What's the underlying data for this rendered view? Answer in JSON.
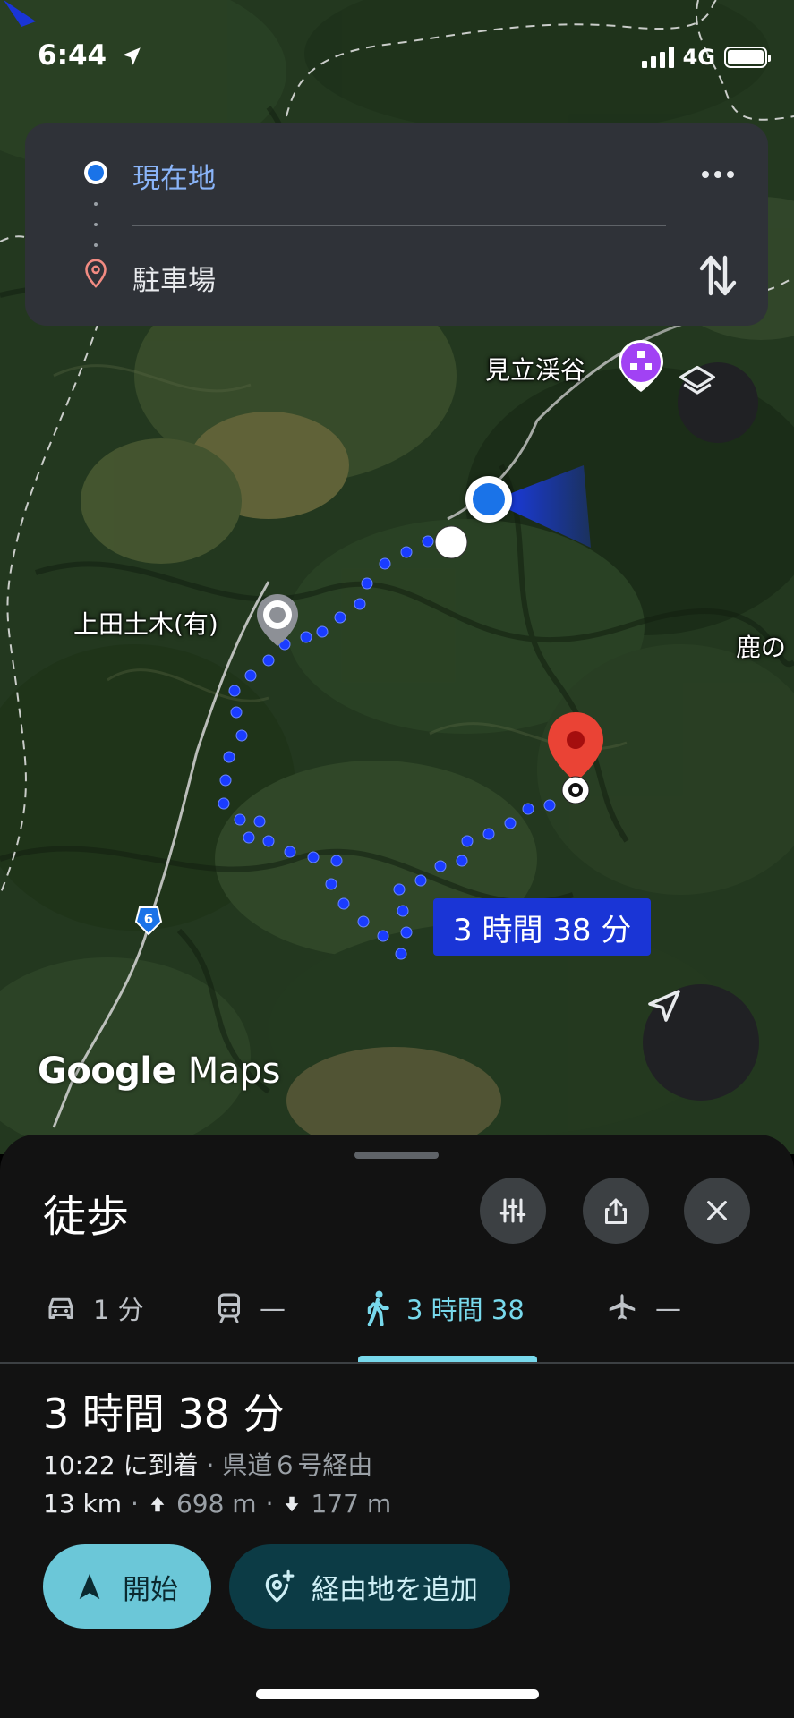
{
  "status_bar": {
    "time": "6:44",
    "network": "4G"
  },
  "directions": {
    "origin": "現在地",
    "destination": "駐車場",
    "more_icon": "more-horizontal-icon",
    "swap_icon": "swap-vertical-icon"
  },
  "map": {
    "poi_label": "見立渓谷",
    "landmark_label": "上田土木(有)",
    "edge_label": "鹿の",
    "road_number": "6",
    "duration_bubble": "3 時間 38 分",
    "logo_google": "Google",
    "logo_maps": "Maps",
    "colors": {
      "route": "#1a3cff",
      "origin_blue": "#1a73e8",
      "destination_red": "#ea4335",
      "poi_purple": "#a142f4"
    }
  },
  "sheet": {
    "title": "徒歩",
    "buttons": [
      "tune-icon",
      "share-icon",
      "close-icon"
    ],
    "tabs": [
      {
        "icon": "car-icon",
        "label": "1 分"
      },
      {
        "icon": "train-icon",
        "label": "—"
      },
      {
        "icon": "walk-icon",
        "label": "3 時間 38",
        "active": true
      },
      {
        "icon": "flight-icon",
        "label": "—"
      }
    ],
    "route": {
      "duration": "3 時間 38 分",
      "arrival_time": "10:22",
      "arrival_suffix": "に到着",
      "via": "県道６号経由",
      "distance": "13 km",
      "ascent": "698 m",
      "descent": "177 m"
    },
    "start_label": "開始",
    "add_waypoint_label": "経由地を追加",
    "accent_color": "#78d9ec"
  }
}
